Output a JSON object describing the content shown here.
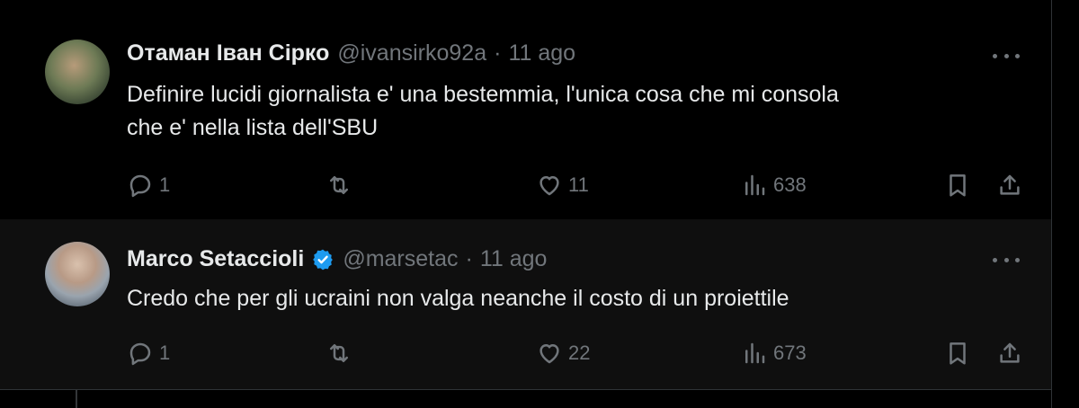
{
  "tweets": [
    {
      "display_name": "Отаман Іван Сірко",
      "handle": "@ivansirko92a",
      "separator": "·",
      "time": "11 ago",
      "verified": false,
      "text_lines": [
        "Definire lucidi giornalista e' una bestemmia, l'unica cosa che mi consola",
        "che e' nella lista dell'SBU"
      ],
      "replies": "1",
      "reposts": "",
      "likes": "11",
      "views": "638"
    },
    {
      "display_name": "Marco Setaccioli",
      "handle": "@marsetac",
      "separator": "·",
      "time": "11 ago",
      "verified": true,
      "text_lines": [
        "Credo che per gli ucraini non valga neanche il costo di un proiettile"
      ],
      "replies": "1",
      "reposts": "",
      "likes": "22",
      "views": "673"
    }
  ],
  "icons": {
    "more": "more-horizontal-icon",
    "reply": "reply-icon",
    "repost": "repost-icon",
    "like": "heart-icon",
    "views": "views-icon",
    "bookmark": "bookmark-icon",
    "share": "share-icon",
    "verified": "verified-badge-icon"
  },
  "colors": {
    "background": "#000000",
    "reply_background": "#0f0f0f",
    "text_primary": "#e7e9ea",
    "text_secondary": "#71767b",
    "verified_blue": "#1d9bf0",
    "border": "#2f3336"
  }
}
